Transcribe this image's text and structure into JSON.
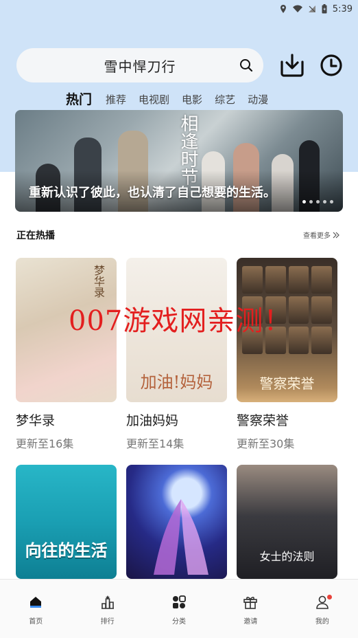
{
  "status_bar": {
    "time": "5:39",
    "icons": [
      "location-icon",
      "wifi-icon",
      "sim-icon",
      "battery-icon"
    ]
  },
  "search": {
    "query": "雪中悍刀行"
  },
  "tabs": [
    {
      "label": "热门",
      "active": true
    },
    {
      "label": "推荐",
      "active": false
    },
    {
      "label": "电视剧",
      "active": false
    },
    {
      "label": "电影",
      "active": false
    },
    {
      "label": "综艺",
      "active": false
    },
    {
      "label": "动漫",
      "active": false
    }
  ],
  "banner": {
    "caption": "重新认识了彼此，也认清了自己想要的生活。",
    "poster_text": "相逢时节",
    "slides": 5,
    "current_slide": 1
  },
  "section": {
    "title": "正在热播",
    "more_label": "查看更多"
  },
  "cards": [
    {
      "name": "梦华录",
      "update": "更新至16集",
      "poster_text": "梦华录"
    },
    {
      "name": "加油妈妈",
      "update": "更新至14集",
      "poster_text": "加油!妈妈"
    },
    {
      "name": "警察荣誉",
      "update": "更新至30集",
      "poster_text": "警察荣誉"
    },
    {
      "poster_text": "向往的生活"
    },
    {
      "poster_text": ""
    },
    {
      "poster_text": "女士的法则"
    }
  ],
  "watermark": "007游戏网亲测！",
  "bottom_nav": [
    {
      "label": "首页",
      "icon": "home-icon",
      "active": true
    },
    {
      "label": "排行",
      "icon": "rank-icon",
      "active": false
    },
    {
      "label": "分类",
      "icon": "category-icon",
      "active": false
    },
    {
      "label": "邀请",
      "icon": "gift-icon",
      "active": false
    },
    {
      "label": "我的",
      "icon": "profile-icon",
      "active": false,
      "badge": true
    }
  ],
  "colors": {
    "header_bg": "#cfe3f8",
    "watermark": "#e31f1f",
    "badge": "#e8423b"
  }
}
